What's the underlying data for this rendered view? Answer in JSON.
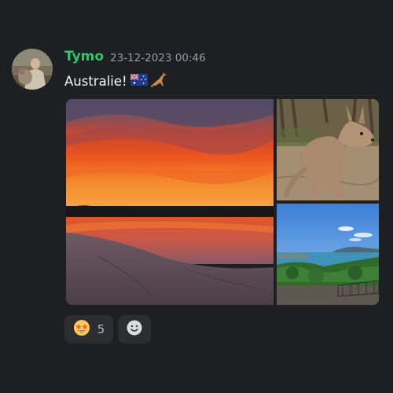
{
  "message": {
    "username": "Tymo",
    "username_color": "#2dc770",
    "timestamp": "23-12-2023 00:46",
    "text": "Australie!",
    "inline_emojis": [
      "flag-australia-icon",
      "kangaroo-icon"
    ]
  },
  "attachments": [
    {
      "subject": "sunset-over-beach"
    },
    {
      "subject": "kangaroo"
    },
    {
      "subject": "coastal-view"
    }
  ],
  "reactions": [
    {
      "emoji": "star-struck-icon",
      "count": "5"
    }
  ],
  "add_reaction": {
    "icon": "add-reaction-icon"
  },
  "colors": {
    "background": "#1e1f22",
    "reaction_background": "#2b2d31",
    "timestamp": "#949ba4",
    "text": "#f2f3f5"
  }
}
